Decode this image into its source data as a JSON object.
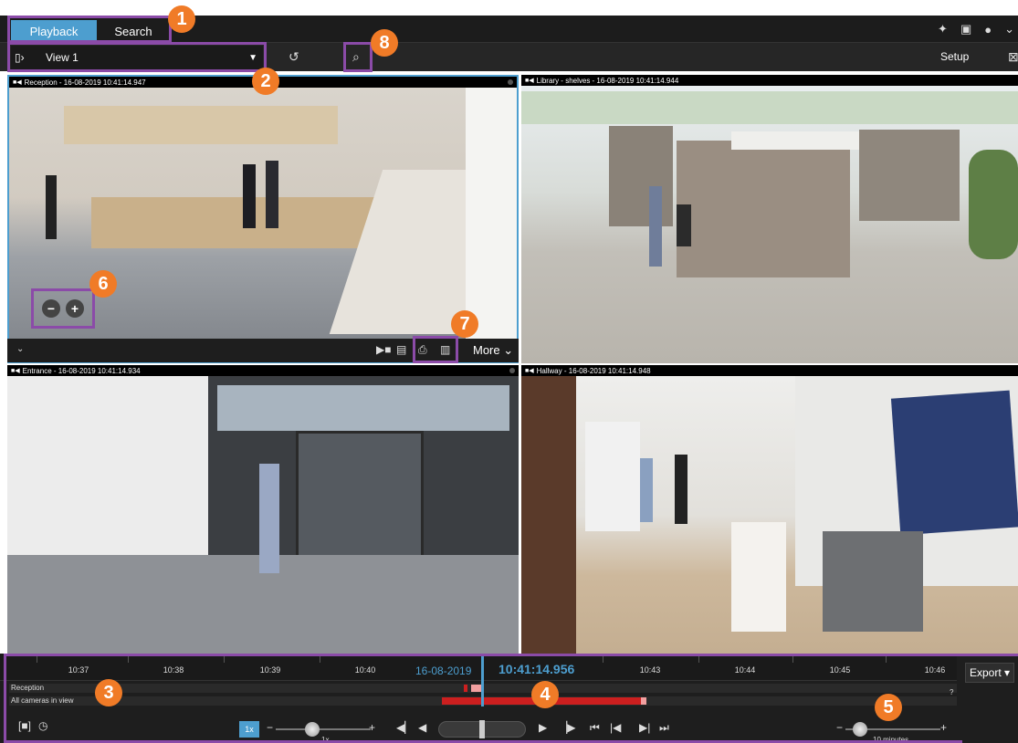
{
  "tabs": {
    "playback": "Playback",
    "search": "Search"
  },
  "view_selector": {
    "label": "View 1"
  },
  "setup_label": "Setup",
  "cameras": [
    {
      "title": "Reception - 16-08-2019 10:41:14.947"
    },
    {
      "title": "Library - shelves - 16-08-2019 10:41:14.944"
    },
    {
      "title": "Entrance - 16-08-2019 10:41:14.934"
    },
    {
      "title": "Hallway - 16-08-2019 10:41:14.948"
    }
  ],
  "tile_toolbar": {
    "more_label": "More"
  },
  "zoom": {
    "minus": "−",
    "plus": "+"
  },
  "callouts": [
    "1",
    "2",
    "3",
    "4",
    "5",
    "6",
    "7",
    "8"
  ],
  "timeline": {
    "ticks": [
      "10:37",
      "10:38",
      "10:39",
      "10:40",
      "10:43",
      "10:44",
      "10:45",
      "10:46"
    ],
    "date": "16-08-2019",
    "time": "10:41:14.956",
    "lanes": [
      "Reception",
      "All cameras in view"
    ],
    "help": "?",
    "export_label": "Export",
    "speed_badge": "1x",
    "speed_value": "1x",
    "timespan_value": "10 minutes"
  },
  "colors": {
    "accent": "#4d9ecf",
    "highlight": "#8b4ba8",
    "callout": "#f07b27",
    "recording": "#cc1f1f",
    "motion": "#f2a0a0"
  }
}
